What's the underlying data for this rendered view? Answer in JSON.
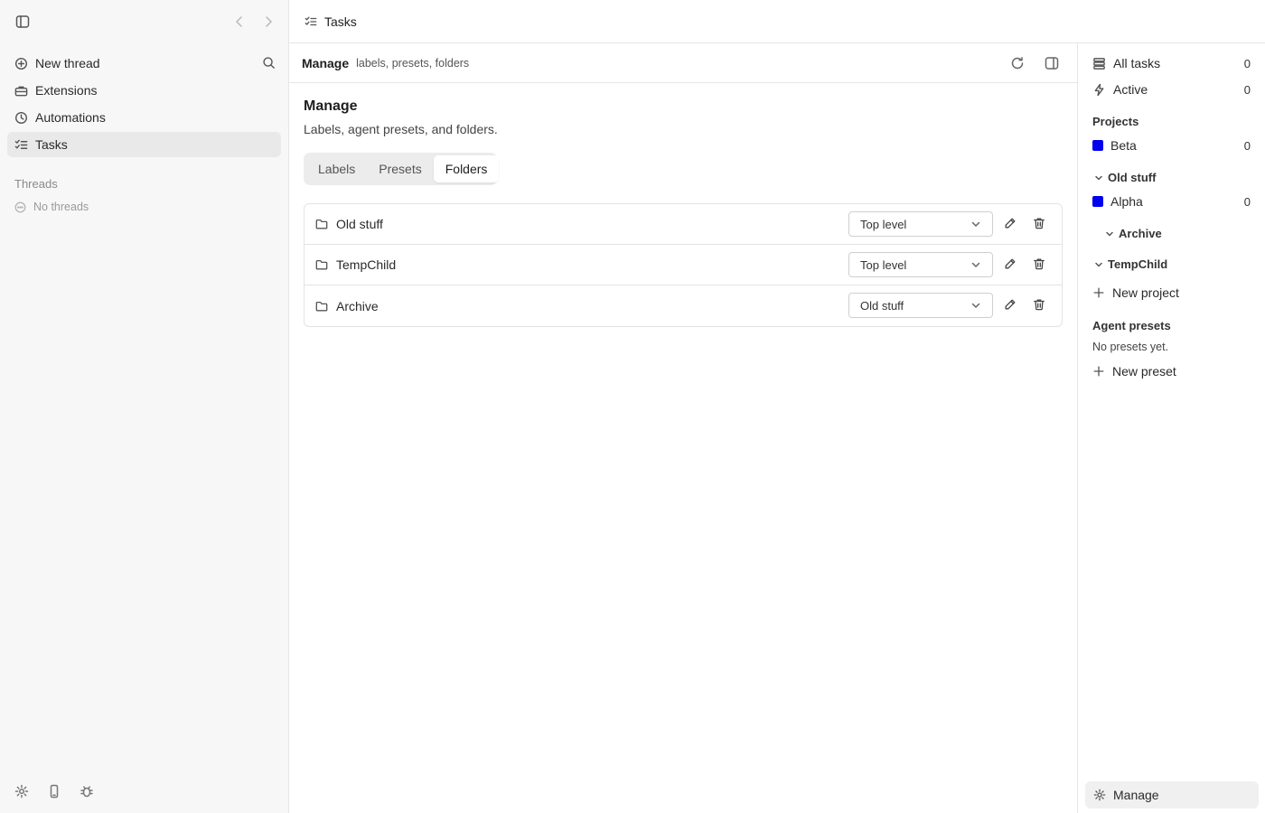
{
  "left_sidebar": {
    "nav": [
      {
        "label": "New thread",
        "icon": "plus-circle-icon"
      },
      {
        "label": "Extensions",
        "icon": "briefcase-icon"
      },
      {
        "label": "Automations",
        "icon": "clock-icon"
      },
      {
        "label": "Tasks",
        "icon": "checklist-icon"
      }
    ],
    "threads_heading": "Threads",
    "no_threads": "No threads"
  },
  "header": {
    "title": "Tasks"
  },
  "subbar": {
    "title": "Manage",
    "subtitle": "labels, presets, folders"
  },
  "manage": {
    "heading": "Manage",
    "description": "Labels, agent presets, and folders.",
    "tabs": [
      {
        "label": "Labels"
      },
      {
        "label": "Presets"
      },
      {
        "label": "Folders"
      }
    ],
    "selected_tab": "Folders",
    "folders": [
      {
        "name": "Old stuff",
        "parent": "Top level"
      },
      {
        "name": "TempChild",
        "parent": "Top level"
      },
      {
        "name": "Archive",
        "parent": "Old stuff"
      }
    ]
  },
  "right_sidebar": {
    "all_tasks": {
      "label": "All tasks",
      "count": "0"
    },
    "active": {
      "label": "Active",
      "count": "0"
    },
    "projects_heading": "Projects",
    "projects": [
      {
        "label": "Beta",
        "count": "0",
        "color": "#0000ee"
      },
      {
        "label": "Alpha",
        "count": "0",
        "color": "#0000ee"
      }
    ],
    "folders": [
      "Old stuff",
      "Archive",
      "TempChild"
    ],
    "new_project": "New project",
    "presets_heading": "Agent presets",
    "no_presets": "No presets yet.",
    "new_preset": "New preset",
    "manage": "Manage"
  }
}
